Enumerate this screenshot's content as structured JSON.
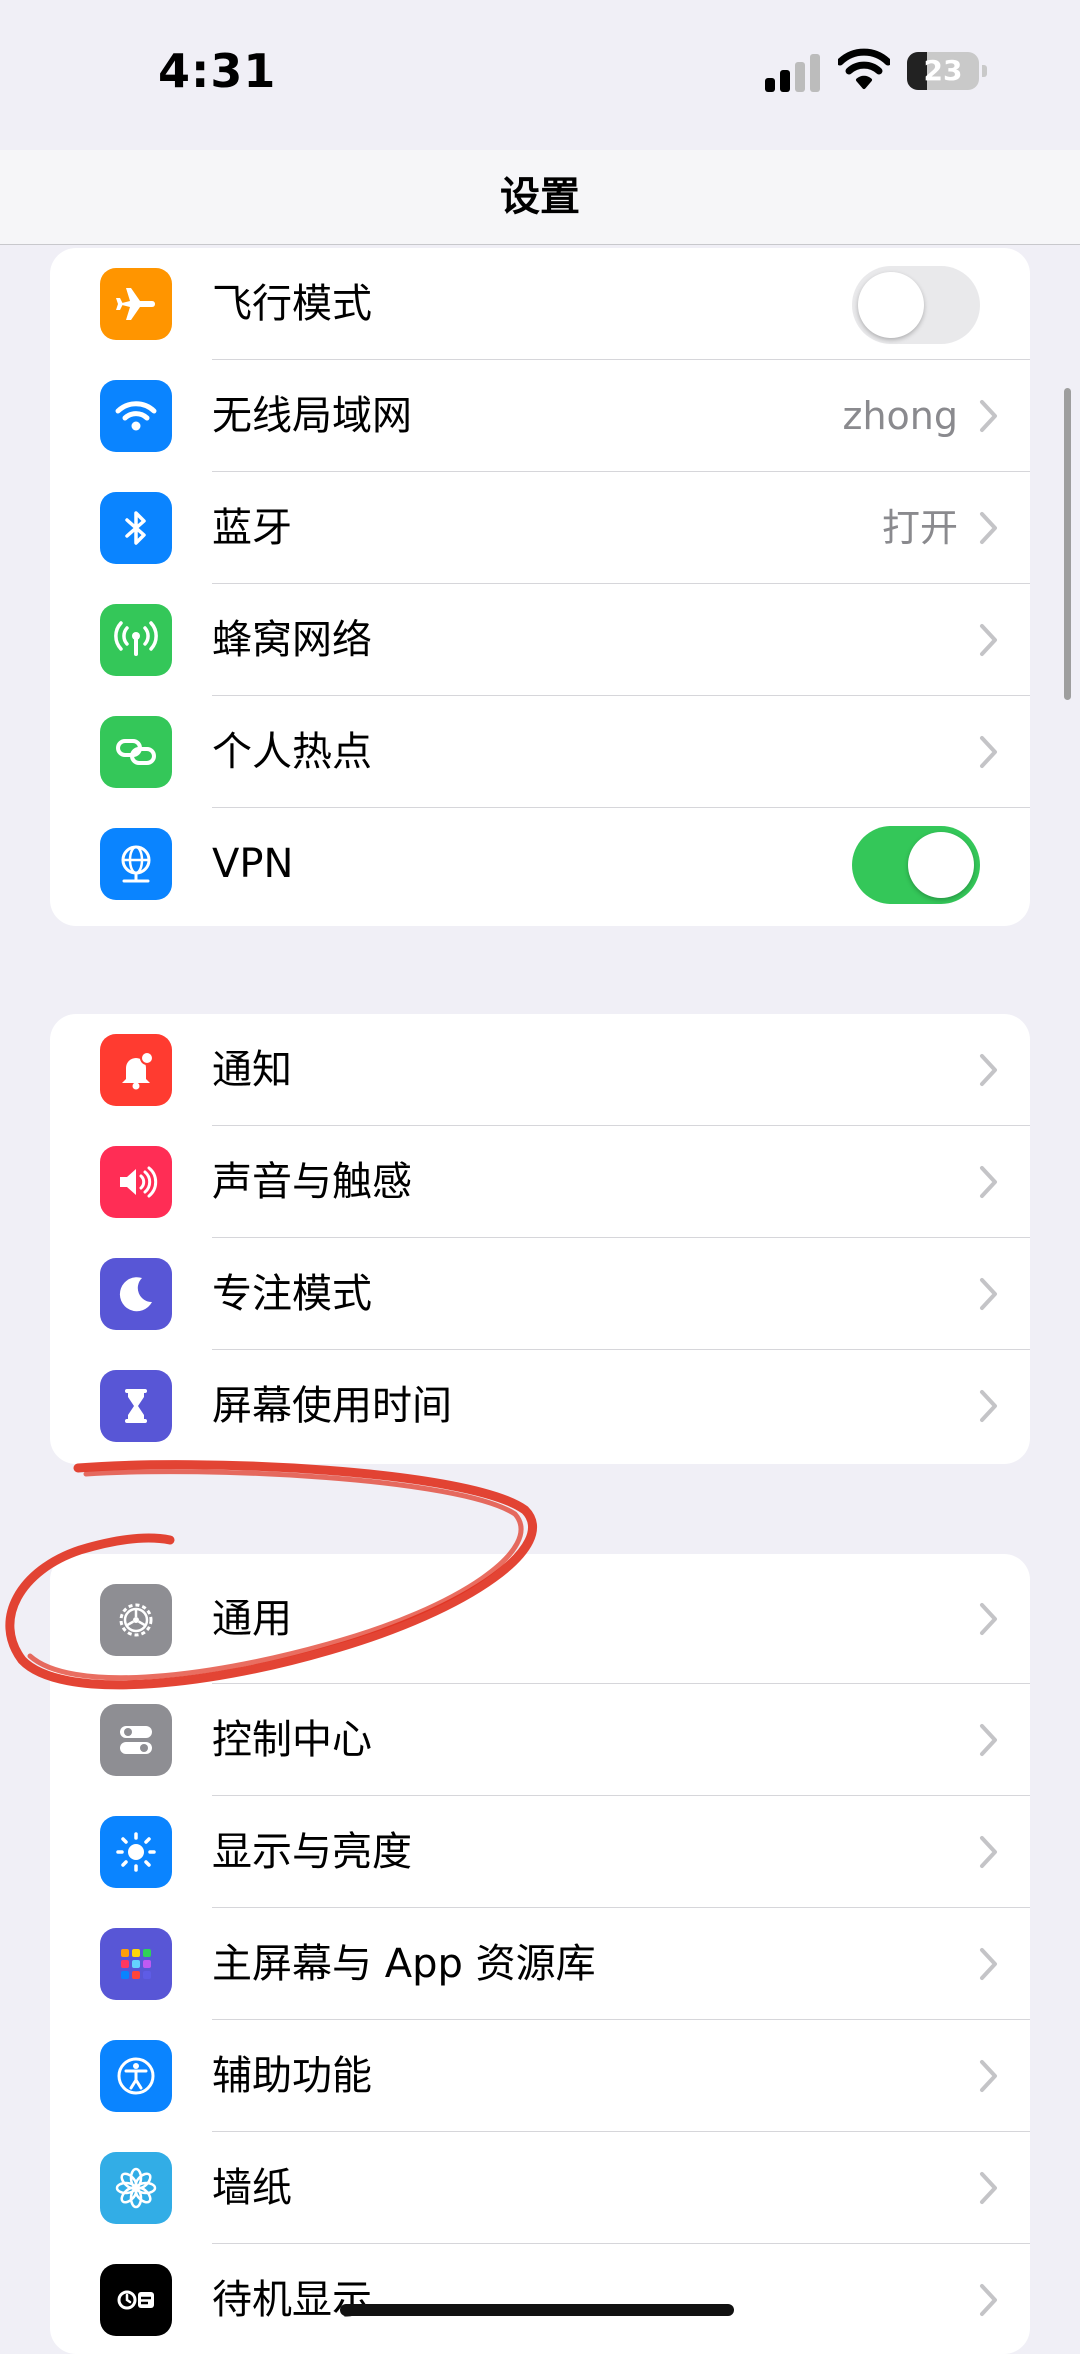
{
  "status_bar": {
    "time": "4:31",
    "battery_level": "23",
    "signal_bars_active": 2,
    "signal_bars_total": 4
  },
  "nav": {
    "title": "设置"
  },
  "group1": [
    {
      "label": "飞行模式",
      "icon": "airplane-icon",
      "icon_color": "#ff9500",
      "control": "toggle",
      "toggle_on": false
    },
    {
      "label": "无线局域网",
      "icon": "wifi-icon",
      "icon_color": "#0a84ff",
      "value": "zhong",
      "control": "chevron"
    },
    {
      "label": "蓝牙",
      "icon": "bluetooth-icon",
      "icon_color": "#0a84ff",
      "value": "打开",
      "control": "chevron"
    },
    {
      "label": "蜂窝网络",
      "icon": "antenna-icon",
      "icon_color": "#34c759",
      "control": "chevron"
    },
    {
      "label": "个人热点",
      "icon": "link-icon",
      "icon_color": "#34c759",
      "control": "chevron"
    },
    {
      "label": "VPN",
      "icon": "globe-icon",
      "icon_color": "#0a84ff",
      "control": "toggle",
      "toggle_on": true
    }
  ],
  "group2": [
    {
      "label": "通知",
      "icon": "bell-icon",
      "icon_color": "#ff3b30",
      "control": "chevron"
    },
    {
      "label": "声音与触感",
      "icon": "speaker-icon",
      "icon_color": "#ff2d55",
      "control": "chevron"
    },
    {
      "label": "专注模式",
      "icon": "moon-icon",
      "icon_color": "#5856d6",
      "control": "chevron"
    },
    {
      "label": "屏幕使用时间",
      "icon": "hourglass-icon",
      "icon_color": "#5856d6",
      "control": "chevron"
    }
  ],
  "group3": [
    {
      "label": "通用",
      "icon": "gear-icon",
      "icon_color": "#8e8e93",
      "control": "chevron"
    },
    {
      "label": "控制中心",
      "icon": "switches-icon",
      "icon_color": "#8e8e93",
      "control": "chevron"
    },
    {
      "label": "显示与亮度",
      "icon": "sun-icon",
      "icon_color": "#0a84ff",
      "control": "chevron"
    },
    {
      "label": "主屏幕与 App 资源库",
      "icon": "app-grid-icon",
      "icon_color": "#5856d6",
      "control": "chevron"
    },
    {
      "label": "辅助功能",
      "icon": "accessibility-icon",
      "icon_color": "#0a84ff",
      "control": "chevron"
    },
    {
      "label": "墙纸",
      "icon": "flower-icon",
      "icon_color": "#32ade6",
      "control": "chevron"
    },
    {
      "label": "待机显示",
      "icon": "standby-icon",
      "icon_color": "#000000",
      "control": "chevron"
    }
  ],
  "annotation": {
    "color": "#e0301e",
    "circled_item": "通用"
  }
}
